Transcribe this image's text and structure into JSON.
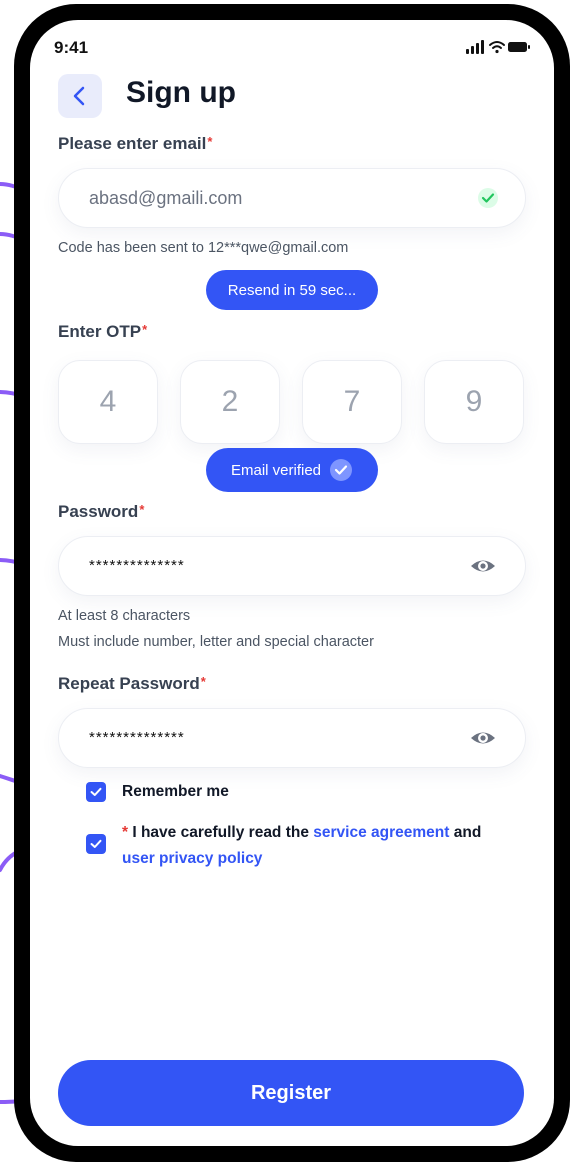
{
  "status_bar": {
    "time": "9:41"
  },
  "header": {
    "title": "Sign up"
  },
  "email": {
    "label": "Please enter email",
    "required_mark": "*",
    "value": "abasd@gmaili.com",
    "verified_icon": "check-icon"
  },
  "code_notice": "Code has been sent to 12***qwe@gmail.com",
  "resend_label": "Resend in 59 sec...",
  "otp": {
    "label": "Enter OTP",
    "required_mark": "*",
    "digits": [
      "4",
      "2",
      "7",
      "9"
    ]
  },
  "email_verified_label": "Email verified",
  "password": {
    "label": "Password",
    "required_mark": "*",
    "value": "**************",
    "hints": [
      "At least 8 characters",
      "Must include number, letter and special character"
    ]
  },
  "repeat_password": {
    "label": "Repeat Password",
    "required_mark": "*",
    "value": "**************"
  },
  "remember_me": {
    "label": "Remember me",
    "checked": true
  },
  "agreement": {
    "required_mark": "*",
    "prefix": " I have carefully read the ",
    "service_link": "service agreement",
    "middle": " and",
    "privacy_link": "user privacy policy",
    "checked": true
  },
  "register_label": "Register",
  "colors": {
    "accent": "#3355f5",
    "arrow": "#8b5cf6",
    "success": "#22c55e",
    "required": "#e53935"
  }
}
